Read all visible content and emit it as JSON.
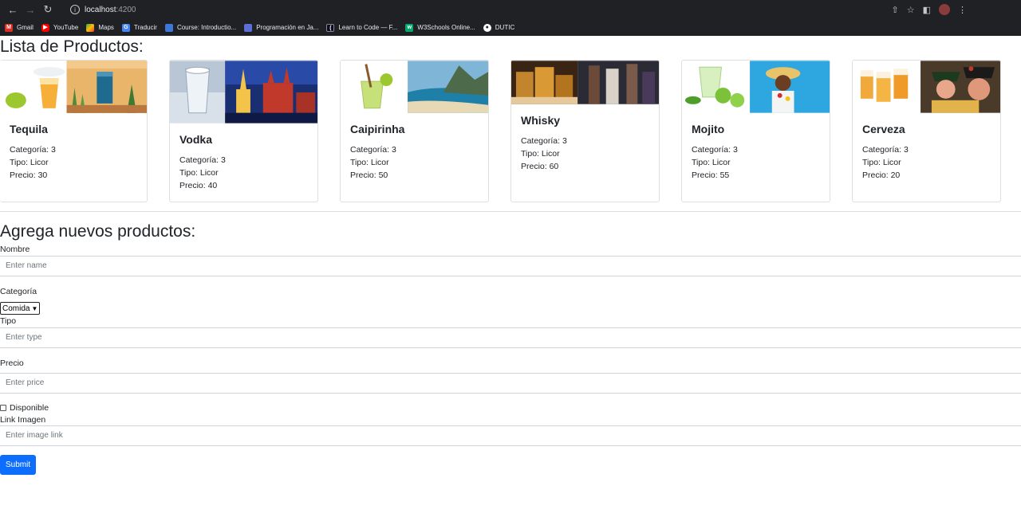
{
  "browser": {
    "url_host": "localhost",
    "url_port": ":4200",
    "bookmarks": [
      {
        "label": "Gmail",
        "color": "#d93025"
      },
      {
        "label": "YouTube",
        "color": "#ff0000"
      },
      {
        "label": "Maps",
        "color": "#34a853"
      },
      {
        "label": "Traducir",
        "color": "#4285f4"
      },
      {
        "label": "Course: Introductio...",
        "color": "#3c78d8"
      },
      {
        "label": "Programación en Ja...",
        "color": "#5b6fd6"
      },
      {
        "label": "Learn to Code — F...",
        "color": "#0a0a23"
      },
      {
        "label": "W3Schools Online...",
        "color": "#04aa6d"
      },
      {
        "label": "DUTIC",
        "color": "#ffffff"
      }
    ]
  },
  "products_section": {
    "title": "Lista de Productos:",
    "products": [
      {
        "name": "Tequila",
        "categoria": "Categoría: 3",
        "tipo": "Tipo: Licor",
        "precio": "Precio: 30"
      },
      {
        "name": "Vodka",
        "categoria": "Categoría: 3",
        "tipo": "Tipo: Licor",
        "precio": "Precio: 40"
      },
      {
        "name": "Caipirinha",
        "categoria": "Categoría: 3",
        "tipo": "Tipo: Licor",
        "precio": "Precio: 50"
      },
      {
        "name": "Whisky",
        "categoria": "Categoría: 3",
        "tipo": "Tipo: Licor",
        "precio": "Precio: 60"
      },
      {
        "name": "Mojito",
        "categoria": "Categoría: 3",
        "tipo": "Tipo: Licor",
        "precio": "Precio: 55"
      },
      {
        "name": "Cerveza",
        "categoria": "Categoría: 3",
        "tipo": "Tipo: Licor",
        "precio": "Precio: 20"
      }
    ]
  },
  "form": {
    "title": "Agrega nuevos productos:",
    "nombre_label": "Nombre",
    "nombre_placeholder": "Enter name",
    "categoria_label": "Categoría",
    "categoria_selected": "Comida",
    "tipo_label": "Tipo",
    "tipo_placeholder": "Enter type",
    "precio_label": "Precio",
    "precio_placeholder": "Enter price",
    "disponible_label": "Disponible",
    "imagen_label": "Link Imagen",
    "imagen_placeholder": "Enter image link",
    "submit_label": "Submit"
  }
}
